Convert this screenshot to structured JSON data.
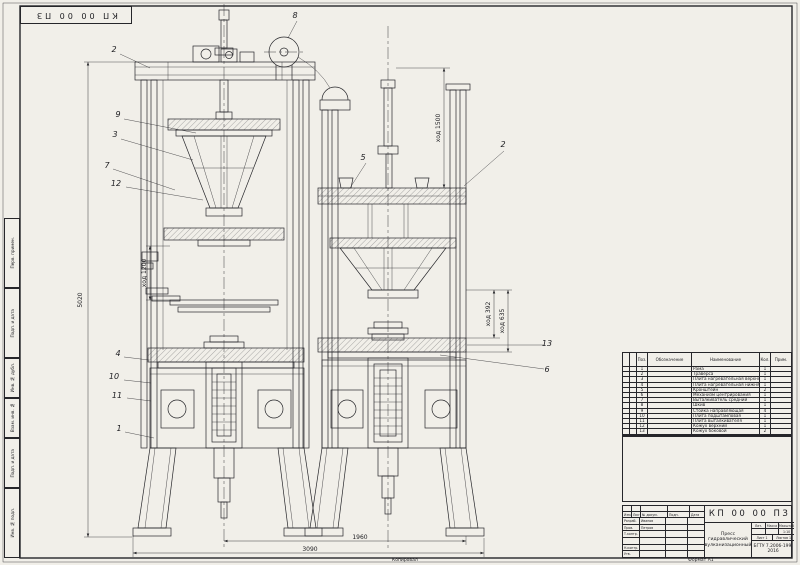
{
  "sheet": {
    "doc_number": "КП 00 00 ПЗ",
    "footer_left": "Копировал",
    "footer_right": "Формат А1"
  },
  "dimensions": {
    "overall_height": "5020",
    "dim_inner_width": "1960",
    "dim_overall_width": "3090",
    "stroke_left": "ход 1200",
    "stroke_right": "ход 1500",
    "stroke_a": "ход 392",
    "stroke_b": "ход 635"
  },
  "callouts": [
    "2",
    "8",
    "9",
    "3",
    "7",
    "12",
    "5",
    "2",
    "4",
    "10",
    "11",
    "1",
    "13",
    "6"
  ],
  "margin_stamps": [
    "Перв. примен.",
    "Подп. и дата",
    "Инв. № дубл.",
    "Взам. инв. №",
    "Подп. и дата",
    "Инв. № подл."
  ],
  "parts_table": {
    "headers": {
      "pos": "Поз.",
      "designation": "Обозначение",
      "name": "Наименование",
      "qty": "Кол.",
      "note": "Прим."
    },
    "rows": [
      {
        "pos": "1",
        "designation": "",
        "name": "Рама",
        "qty": "1",
        "note": ""
      },
      {
        "pos": "2",
        "designation": "",
        "name": "Траверса",
        "qty": "1",
        "note": ""
      },
      {
        "pos": "3",
        "designation": "",
        "name": "Плита нагревательная верхняя",
        "qty": "1",
        "note": ""
      },
      {
        "pos": "4",
        "designation": "",
        "name": "Плита нагревательная нижняя",
        "qty": "1",
        "note": ""
      },
      {
        "pos": "5",
        "designation": "",
        "name": "Кронштейн",
        "qty": "2",
        "note": ""
      },
      {
        "pos": "6",
        "designation": "",
        "name": "Механизм центрирования",
        "qty": "1",
        "note": ""
      },
      {
        "pos": "7",
        "designation": "",
        "name": "Выталкиватель средний",
        "qty": "1",
        "note": ""
      },
      {
        "pos": "8",
        "designation": "",
        "name": "Шкив",
        "qty": "1",
        "note": ""
      },
      {
        "pos": "9",
        "designation": "",
        "name": "Стойка направляющая",
        "qty": "4",
        "note": ""
      },
      {
        "pos": "10",
        "designation": "",
        "name": "Плита подштамповая",
        "qty": "1",
        "note": ""
      },
      {
        "pos": "11",
        "designation": "",
        "name": "Плита выталкивателя",
        "qty": "1",
        "note": ""
      },
      {
        "pos": "12",
        "designation": "",
        "name": "Кожух верхний",
        "qty": "1",
        "note": ""
      },
      {
        "pos": "13",
        "designation": "",
        "name": "Кожух боковой",
        "qty": "2",
        "note": ""
      }
    ]
  },
  "title_block": {
    "doc_number": "КП 00 00 ПЗ",
    "title_line": "Пресс гидравлический вулканизационный",
    "org": "БГТУ 7.2006-199, 2016",
    "header_cells": [
      "Изм.",
      "Лист",
      "№ докум.",
      "Подп.",
      "Дата"
    ],
    "roles": [
      {
        "role": "Разраб.",
        "name": "Иванов"
      },
      {
        "role": "Пров.",
        "name": "Петров"
      },
      {
        "role": "Т.контр.",
        "name": ""
      },
      {
        "role": "",
        "name": ""
      },
      {
        "role": "Н.контр.",
        "name": ""
      },
      {
        "role": "Утв.",
        "name": ""
      }
    ],
    "lit_label": "Лит.",
    "mass_label": "Масса",
    "scale_label": "Масштаб",
    "scale_value": "1:10",
    "sheet_label": "Лист",
    "sheet_value": "1",
    "sheets_label": "Листов",
    "sheets_value": "1"
  }
}
